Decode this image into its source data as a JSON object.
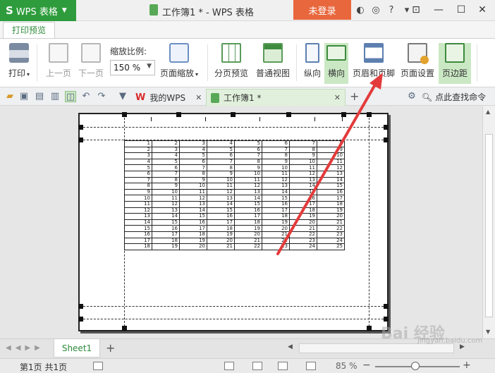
{
  "window": {
    "app_name": "WPS 表格",
    "title": "工作簿1 * - WPS 表格",
    "login_label": "未登录"
  },
  "ribbon": {
    "active_tab": "打印预览",
    "buttons": {
      "print": "打印",
      "prev_page": "上一页",
      "next_page": "下一页",
      "zoom_label": "缩放比例:",
      "zoom_value": "150 %",
      "page_zoom": "页面缩放",
      "page_break_preview": "分页预览",
      "normal_view": "普通视图",
      "portrait": "纵向",
      "landscape": "横向",
      "header_footer": "页眉和页脚",
      "page_setup": "页面设置",
      "margins": "页边距"
    }
  },
  "tabs": {
    "my_wps": "我的WPS",
    "workbook": "工作簿1 *",
    "search_command": "点此查找命令"
  },
  "sheet_table": [
    [
      1,
      2,
      3,
      4,
      5,
      6,
      7,
      8
    ],
    [
      2,
      3,
      4,
      5,
      6,
      7,
      8,
      9
    ],
    [
      3,
      4,
      5,
      6,
      7,
      8,
      9,
      10
    ],
    [
      4,
      5,
      6,
      7,
      8,
      9,
      10,
      11
    ],
    [
      5,
      6,
      7,
      8,
      9,
      10,
      11,
      12
    ],
    [
      6,
      7,
      8,
      9,
      10,
      11,
      12,
      13
    ],
    [
      7,
      8,
      9,
      10,
      11,
      12,
      13,
      14
    ],
    [
      8,
      9,
      10,
      11,
      12,
      13,
      14,
      15
    ],
    [
      9,
      10,
      11,
      12,
      13,
      14,
      15,
      16
    ],
    [
      10,
      11,
      12,
      13,
      14,
      15,
      16,
      17
    ],
    [
      11,
      12,
      13,
      14,
      15,
      16,
      17,
      18
    ],
    [
      12,
      13,
      14,
      15,
      16,
      17,
      18,
      19
    ],
    [
      13,
      14,
      15,
      16,
      17,
      18,
      19,
      20
    ],
    [
      14,
      15,
      16,
      17,
      18,
      19,
      20,
      21
    ],
    [
      15,
      16,
      17,
      18,
      19,
      20,
      21,
      22
    ],
    [
      16,
      17,
      18,
      19,
      20,
      21,
      22,
      23
    ],
    [
      17,
      18,
      19,
      20,
      21,
      22,
      23,
      24
    ],
    [
      18,
      19,
      20,
      21,
      22,
      23,
      24,
      25
    ]
  ],
  "sheetbar": {
    "sheet_name": "Sheet1"
  },
  "status": {
    "page_info": "第1页 共1页",
    "zoom": "85 %"
  },
  "watermark": {
    "brand": "Bai 经验",
    "url": "jingyan.baidu.com"
  },
  "colors": {
    "brand_green": "#2e9c3c",
    "login_orange": "#e8673d",
    "annotation_red": "#e33b3b"
  }
}
